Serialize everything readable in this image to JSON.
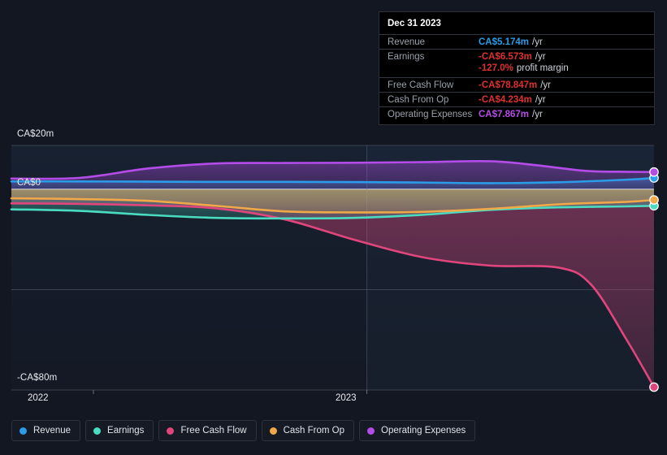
{
  "chart_data": {
    "type": "area",
    "title": "",
    "xlabel": "",
    "ylabel": "",
    "currency": "CA$",
    "y_ticks": [
      "CA$20m",
      "CA$0",
      "-CA$80m"
    ],
    "y_tick_values": [
      20,
      0,
      -80
    ],
    "ylim": [
      -80,
      20
    ],
    "x_ticks": [
      "2022",
      "2023"
    ],
    "grid": true,
    "legend_position": "bottom",
    "series": [
      {
        "name": "Revenue",
        "color": "#2a9ce8",
        "points": [
          {
            "x": 2021.7,
            "y": 3.6
          },
          {
            "x": 2021.95,
            "y": 3.6
          },
          {
            "x": 2022.2,
            "y": 3.5
          },
          {
            "x": 2022.45,
            "y": 3.4
          },
          {
            "x": 2022.7,
            "y": 3.4
          },
          {
            "x": 2022.95,
            "y": 3.3
          },
          {
            "x": 2023.2,
            "y": 3.1
          },
          {
            "x": 2023.45,
            "y": 2.8
          },
          {
            "x": 2023.7,
            "y": 3.2
          },
          {
            "x": 2023.95,
            "y": 4.4
          },
          {
            "x": 2024.05,
            "y": 5.174
          }
        ],
        "end_value": 5.174
      },
      {
        "name": "Earnings",
        "color": "#4adcc0",
        "points": [
          {
            "x": 2021.7,
            "y": -8.0
          },
          {
            "x": 2021.95,
            "y": -8.6
          },
          {
            "x": 2022.2,
            "y": -10.2
          },
          {
            "x": 2022.45,
            "y": -11.4
          },
          {
            "x": 2022.7,
            "y": -11.6
          },
          {
            "x": 2022.95,
            "y": -11.4
          },
          {
            "x": 2023.2,
            "y": -10.2
          },
          {
            "x": 2023.45,
            "y": -8.2
          },
          {
            "x": 2023.7,
            "y": -7.2
          },
          {
            "x": 2023.95,
            "y": -6.8
          },
          {
            "x": 2024.05,
            "y": -6.573
          }
        ],
        "end_value": -6.573
      },
      {
        "name": "Free Cash Flow",
        "color": "#e0467c",
        "points": [
          {
            "x": 2021.7,
            "y": -5.6
          },
          {
            "x": 2021.95,
            "y": -5.8
          },
          {
            "x": 2022.2,
            "y": -6.4
          },
          {
            "x": 2022.45,
            "y": -7.6
          },
          {
            "x": 2022.7,
            "y": -12.0
          },
          {
            "x": 2022.95,
            "y": -20.0
          },
          {
            "x": 2023.2,
            "y": -27.0
          },
          {
            "x": 2023.45,
            "y": -30.4
          },
          {
            "x": 2023.7,
            "y": -31.2
          },
          {
            "x": 2023.82,
            "y": -38.0
          },
          {
            "x": 2023.95,
            "y": -60.0
          },
          {
            "x": 2024.05,
            "y": -78.847
          }
        ],
        "end_value": -78.847
      },
      {
        "name": "Cash From Op",
        "color": "#f0a848",
        "points": [
          {
            "x": 2021.7,
            "y": -3.6
          },
          {
            "x": 2021.95,
            "y": -3.9
          },
          {
            "x": 2022.2,
            "y": -4.6
          },
          {
            "x": 2022.45,
            "y": -6.6
          },
          {
            "x": 2022.7,
            "y": -8.8
          },
          {
            "x": 2022.95,
            "y": -9.2
          },
          {
            "x": 2023.2,
            "y": -9.0
          },
          {
            "x": 2023.45,
            "y": -7.8
          },
          {
            "x": 2023.7,
            "y": -6.0
          },
          {
            "x": 2023.95,
            "y": -5.0
          },
          {
            "x": 2024.05,
            "y": -4.234
          }
        ],
        "end_value": -4.234
      },
      {
        "name": "Operating Expenses",
        "color": "#b44ce8",
        "points": [
          {
            "x": 2021.7,
            "y": 4.9
          },
          {
            "x": 2021.95,
            "y": 5.2
          },
          {
            "x": 2022.2,
            "y": 9.5
          },
          {
            "x": 2022.45,
            "y": 11.8
          },
          {
            "x": 2022.7,
            "y": 12.0
          },
          {
            "x": 2022.95,
            "y": 12.1
          },
          {
            "x": 2023.2,
            "y": 12.4
          },
          {
            "x": 2023.45,
            "y": 12.8
          },
          {
            "x": 2023.62,
            "y": 11.0
          },
          {
            "x": 2023.8,
            "y": 8.4
          },
          {
            "x": 2023.95,
            "y": 8.0
          },
          {
            "x": 2024.05,
            "y": 7.867
          }
        ],
        "end_value": 7.867
      }
    ]
  },
  "tooltip": {
    "date": "Dec 31 2023",
    "rows": [
      {
        "key": "Revenue",
        "value": "CA$5.174m",
        "unit": "/yr",
        "color": "#2a9ce8"
      },
      {
        "key": "Earnings",
        "value": "-CA$6.573m",
        "unit": "/yr",
        "color": "#e03030"
      },
      {
        "key": "",
        "value": "-127.0%",
        "unit": "profit margin",
        "color": "#e03030"
      },
      {
        "key": "Free Cash Flow",
        "value": "-CA$78.847m",
        "unit": "/yr",
        "color": "#e03030"
      },
      {
        "key": "Cash From Op",
        "value": "-CA$4.234m",
        "unit": "/yr",
        "color": "#e03030"
      },
      {
        "key": "Operating Expenses",
        "value": "CA$7.867m",
        "unit": "/yr",
        "color": "#b44ce8"
      }
    ]
  },
  "axis": {
    "y_top_label": "CA$20m",
    "y_zero_label": "CA$0",
    "y_bottom_label": "-CA$80m",
    "x_left_label": "2022",
    "x_right_label": "2023"
  },
  "legend": {
    "items": [
      {
        "label": "Revenue",
        "color": "#2a9ce8"
      },
      {
        "label": "Earnings",
        "color": "#4adcc0"
      },
      {
        "label": "Free Cash Flow",
        "color": "#e0467c"
      },
      {
        "label": "Cash From Op",
        "color": "#f0a848"
      },
      {
        "label": "Operating Expenses",
        "color": "#b44ce8"
      }
    ]
  }
}
